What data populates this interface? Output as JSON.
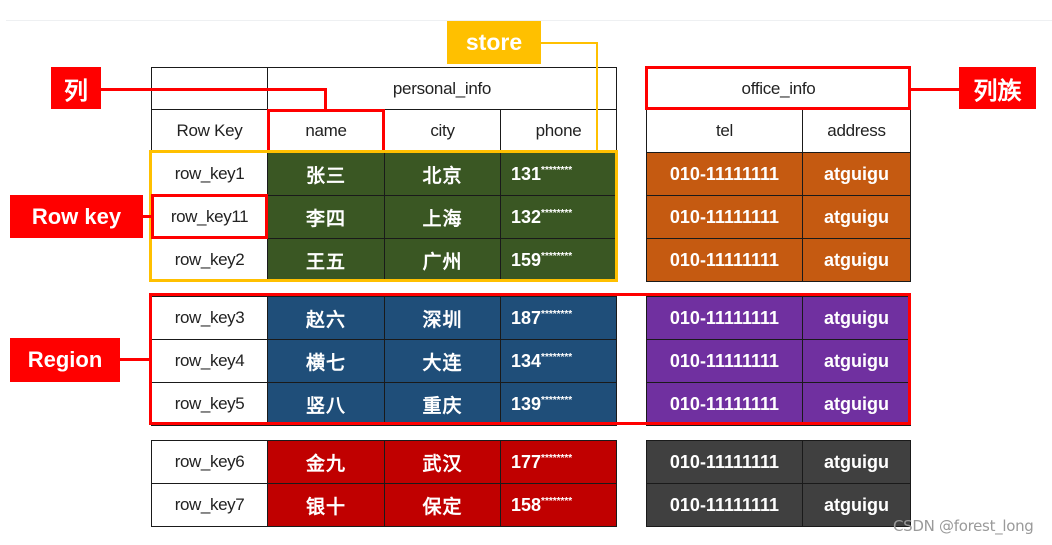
{
  "headers": {
    "row_key_family": "",
    "personal_family": "personal_info",
    "office_family": "office_info",
    "row_key": "Row Key",
    "columns": [
      "name",
      "city",
      "phone",
      "tel",
      "address"
    ]
  },
  "groups": [
    {
      "color": "#3a5723",
      "office_color": "#c55a11",
      "rows": [
        {
          "row_key": "row_key1",
          "name": "张三",
          "city": "北京",
          "phone": "131********",
          "tel": "010-11111111",
          "address": "atguigu"
        },
        {
          "row_key": "row_key11",
          "name": "李四",
          "city": "上海",
          "phone": "132********",
          "tel": "010-11111111",
          "address": "atguigu"
        },
        {
          "row_key": "row_key2",
          "name": "王五",
          "city": "广州",
          "phone": "159********",
          "tel": "010-11111111",
          "address": "atguigu"
        }
      ]
    },
    {
      "color": "#1f4e79",
      "office_color": "#7030a0",
      "rows": [
        {
          "row_key": "row_key3",
          "name": "赵六",
          "city": "深圳",
          "phone": "187********",
          "tel": "010-11111111",
          "address": "atguigu"
        },
        {
          "row_key": "row_key4",
          "name": "横七",
          "city": "大连",
          "phone": "134********",
          "tel": "010-11111111",
          "address": "atguigu"
        },
        {
          "row_key": "row_key5",
          "name": "竖八",
          "city": "重庆",
          "phone": "139********",
          "tel": "010-11111111",
          "address": "atguigu"
        }
      ]
    },
    {
      "color": "#c00000",
      "office_color": "#404040",
      "rows": [
        {
          "row_key": "row_key6",
          "name": "金九",
          "city": "武汉",
          "phone": "177********",
          "tel": "010-11111111",
          "address": "atguigu"
        },
        {
          "row_key": "row_key7",
          "name": "银十",
          "city": "保定",
          "phone": "158********",
          "tel": "010-11111111",
          "address": "atguigu"
        }
      ]
    }
  ],
  "annotations": {
    "column": "列",
    "store": "store",
    "row_key": "Row key",
    "region": "Region",
    "column_family": "列族"
  },
  "colors": {
    "annotation_red": "#ff0000",
    "annotation_yellow": "#ffc000"
  },
  "watermark": "CSDN @forest_long"
}
